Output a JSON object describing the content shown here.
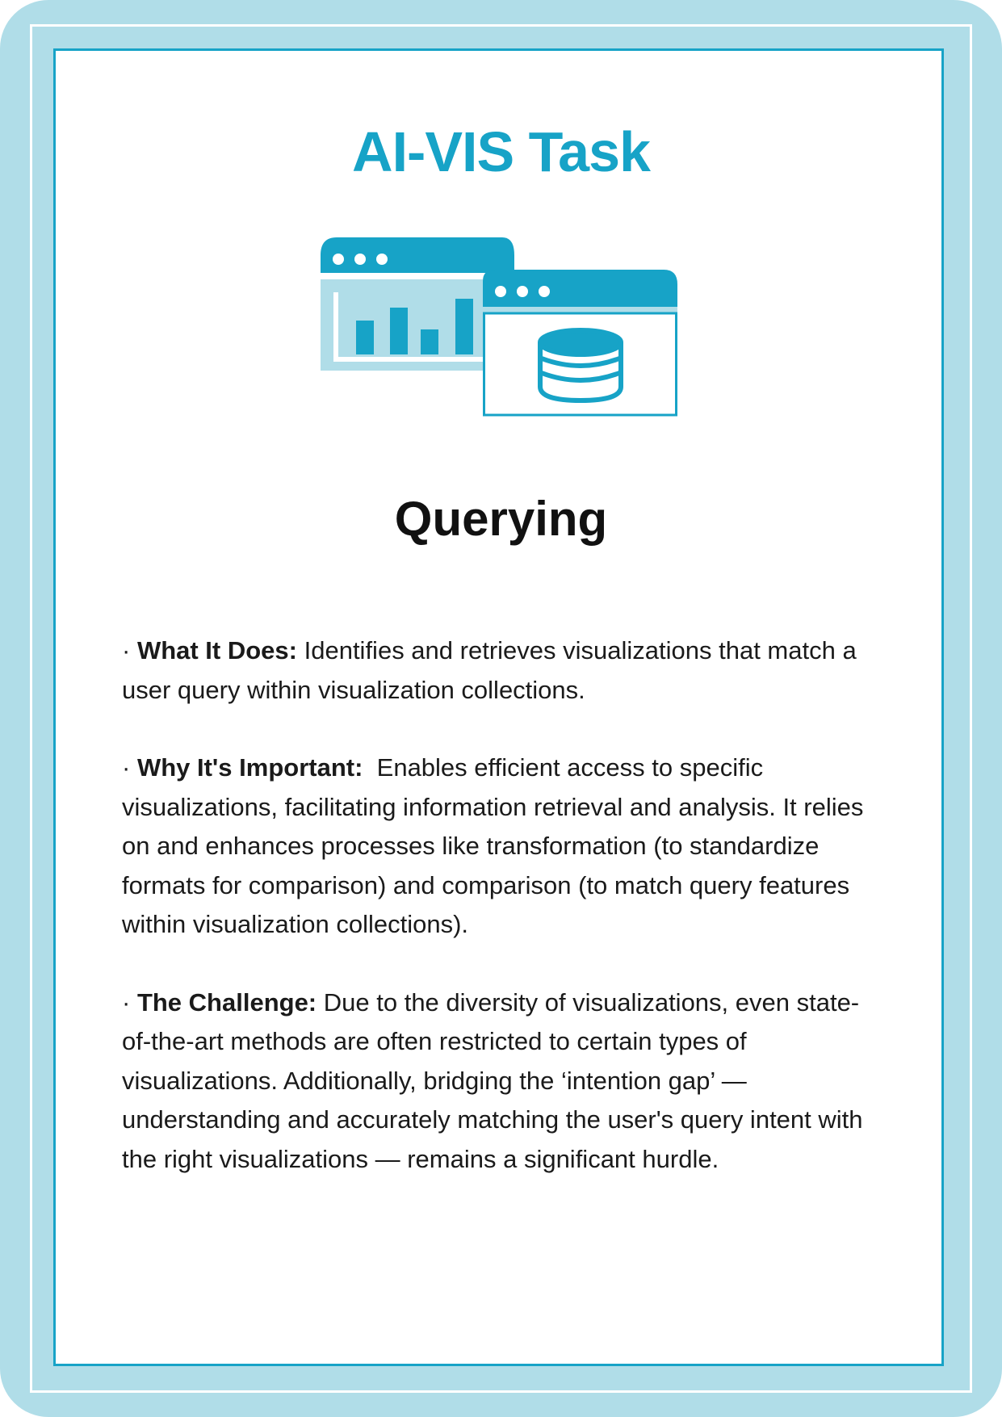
{
  "title": "AI-VIS Task",
  "icon": "browser-windows-chart-database-icon",
  "heading": "Querying",
  "colors": {
    "accent": "#17a3c7",
    "light": "#b0dde8"
  },
  "sections": [
    {
      "label": "What It Does:",
      "text": " Identifies and retrieves visualizations that match a user query within visualization collections."
    },
    {
      "label": "Why It's Important:",
      "text": "  Enables efficient access to specific visualizations, facilitating information retrieval and analysis. It relies on and enhances processes like transformation (to standardize formats for comparison) and comparison (to match query features within visualization collections)."
    },
    {
      "label": "The Challenge:",
      "text": " Due to the diversity of visualizations, even state-of-the-art methods are often restricted to certain types of visualizations. Additionally, bridging the ‘intention gap’ — understanding and accurately matching the user's query intent with the right visualizations — remains a significant hurdle."
    }
  ],
  "bullet": "· "
}
